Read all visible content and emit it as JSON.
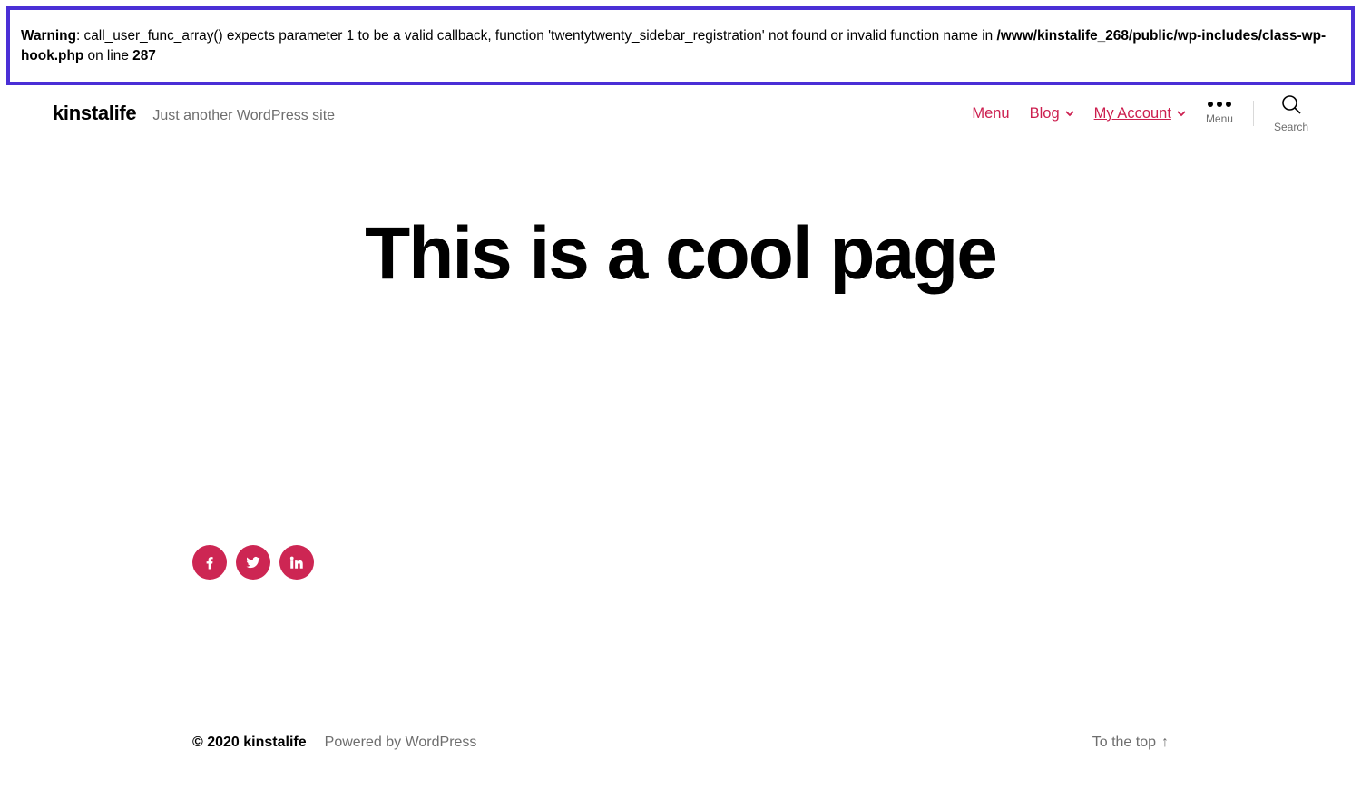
{
  "warning": {
    "label": "Warning",
    "msg_part1": ": call_user_func_array() expects parameter 1 to be a valid callback, function 'twentytwenty_sidebar_registration' not found or invalid function name in ",
    "file_path": "/www/kinstalife_268/public/wp-includes/class-wp-hook.php",
    "on_line_text": " on line ",
    "line_number": "287"
  },
  "header": {
    "site_title": "kinstalife",
    "tagline": "Just another WordPress site",
    "nav": {
      "menu": "Menu",
      "blog": "Blog",
      "my_account": "My Account"
    },
    "menu_toggle_label": "Menu",
    "search_toggle_label": "Search"
  },
  "page": {
    "title": "This is a cool page"
  },
  "social": {
    "facebook": "facebook-icon",
    "twitter": "twitter-icon",
    "linkedin": "linkedin-icon"
  },
  "footer": {
    "copyright": "© 2020 kinstalife",
    "powered": "Powered by WordPress",
    "to_top": "To the top",
    "arrow": "↑"
  },
  "colors": {
    "accent": "#cd2653",
    "highlight_border": "#4a2fd6"
  }
}
